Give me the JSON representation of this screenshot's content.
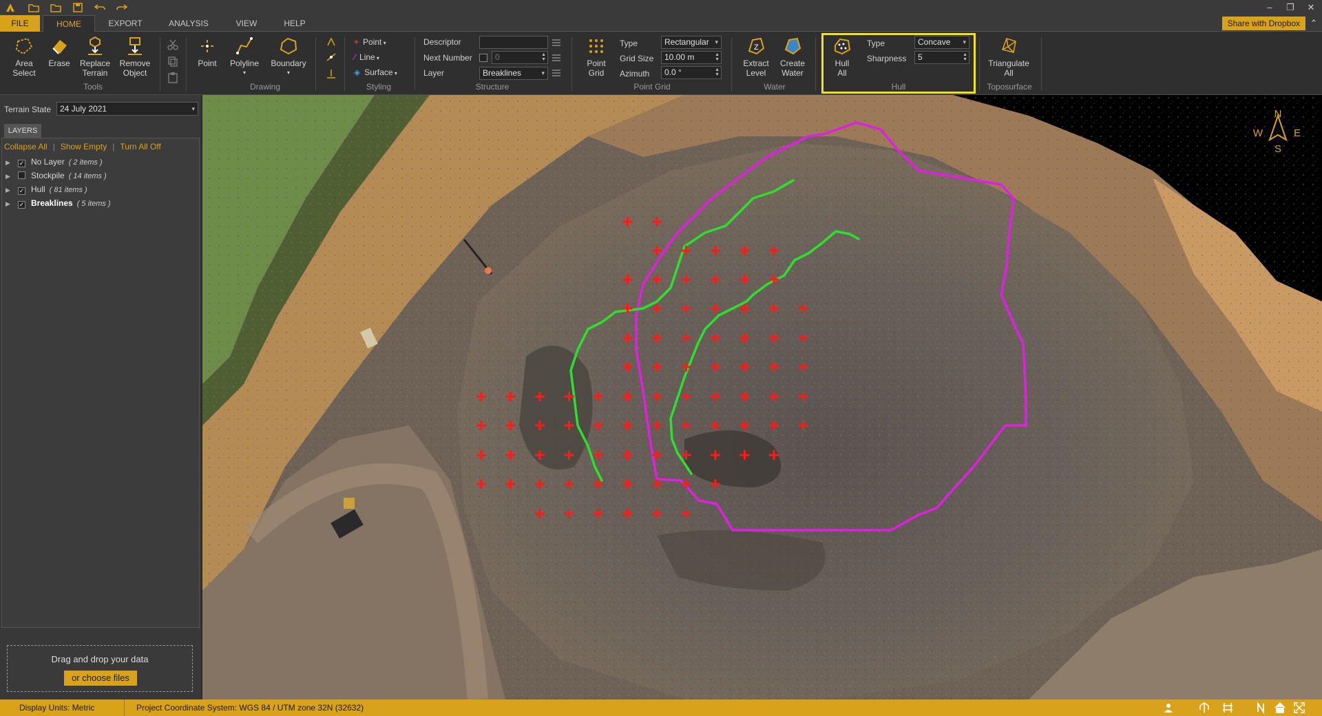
{
  "titlebar": {
    "icons": [
      "app-logo-icon",
      "new-folder-icon",
      "open-folder-icon",
      "save-icon",
      "undo-icon",
      "redo-icon"
    ],
    "window_controls": [
      "minimize-icon",
      "restore-icon",
      "close-icon"
    ]
  },
  "tabs": {
    "file": "FILE",
    "items": [
      "HOME",
      "EXPORT",
      "ANALYSIS",
      "VIEW",
      "HELP"
    ],
    "active": "HOME",
    "share": "Share with Dropbox"
  },
  "ribbon": {
    "tools": {
      "label": "Tools",
      "area_select": [
        "Area",
        "Select"
      ],
      "erase": "Erase",
      "replace_terrain": [
        "Replace",
        "Terrain"
      ],
      "remove_object": [
        "Remove",
        "Object"
      ]
    },
    "drawing": {
      "label": "Drawing",
      "point": "Point",
      "polyline": "Polyline",
      "boundary": "Boundary"
    },
    "styling": {
      "label": "Styling",
      "point": "Point",
      "line": "Line",
      "surface": "Surface"
    },
    "structure": {
      "label": "Structure",
      "descriptor_label": "Descriptor",
      "descriptor_value": "",
      "next_number_label": "Next Number",
      "next_number_value": "0",
      "layer_label": "Layer",
      "layer_value": "Breaklines"
    },
    "point_grid": {
      "label": "Point Grid",
      "button": [
        "Point",
        "Grid"
      ],
      "type_label": "Type",
      "type_value": "Rectangular",
      "grid_size_label": "Grid Size",
      "grid_size_value": "10.00 m",
      "azimuth_label": "Azimuth",
      "azimuth_value": "0.0 °"
    },
    "water": {
      "label": "Water",
      "extract_level": [
        "Extract",
        "Level"
      ],
      "create_water": [
        "Create",
        "Water"
      ]
    },
    "hull": {
      "label": "Hull",
      "hull_all": [
        "Hull",
        "All"
      ],
      "type_label": "Type",
      "type_value": "Concave",
      "sharpness_label": "Sharpness",
      "sharpness_value": "5"
    },
    "toposurface": {
      "label": "Toposurface",
      "triangulate_all": [
        "Triangulate",
        "All"
      ]
    }
  },
  "left_panel": {
    "terrain_state_label": "Terrain State",
    "terrain_state_value": "24 July 2021",
    "layers_tab": "LAYERS",
    "actions": [
      "Collapse All",
      "Show Empty",
      "Turn All Off"
    ],
    "layers": [
      {
        "name": "No Layer",
        "count": "( 2 items )",
        "checked": true,
        "bold": false
      },
      {
        "name": "Stockpile",
        "count": "( 14 items )",
        "checked": false,
        "bold": false
      },
      {
        "name": "Hull",
        "count": "( 81 items )",
        "checked": true,
        "bold": false
      },
      {
        "name": "Breaklines",
        "count": "( 5 items )",
        "checked": true,
        "bold": true
      }
    ],
    "dropzone_text": "Drag and drop your data",
    "dropzone_button": "or choose files"
  },
  "map": {
    "compass": {
      "n": "N",
      "s": "S",
      "e": "E",
      "w": "W"
    },
    "hull_color": "#e020e0",
    "breakline_color": "#2ee02e",
    "point_color": "#ff1a1a"
  },
  "status": {
    "display_units": "Display Units: Metric",
    "coordinate_system": "Project Coordinate System:  WGS 84 / UTM zone 32N (32632)",
    "icons": [
      "person-icon",
      "network-icon",
      "grid-icon",
      "north-icon",
      "home-icon",
      "fullscreen-icon"
    ]
  },
  "colors": {
    "accent": "#d9a21b",
    "highlight": "#f2e21b"
  }
}
